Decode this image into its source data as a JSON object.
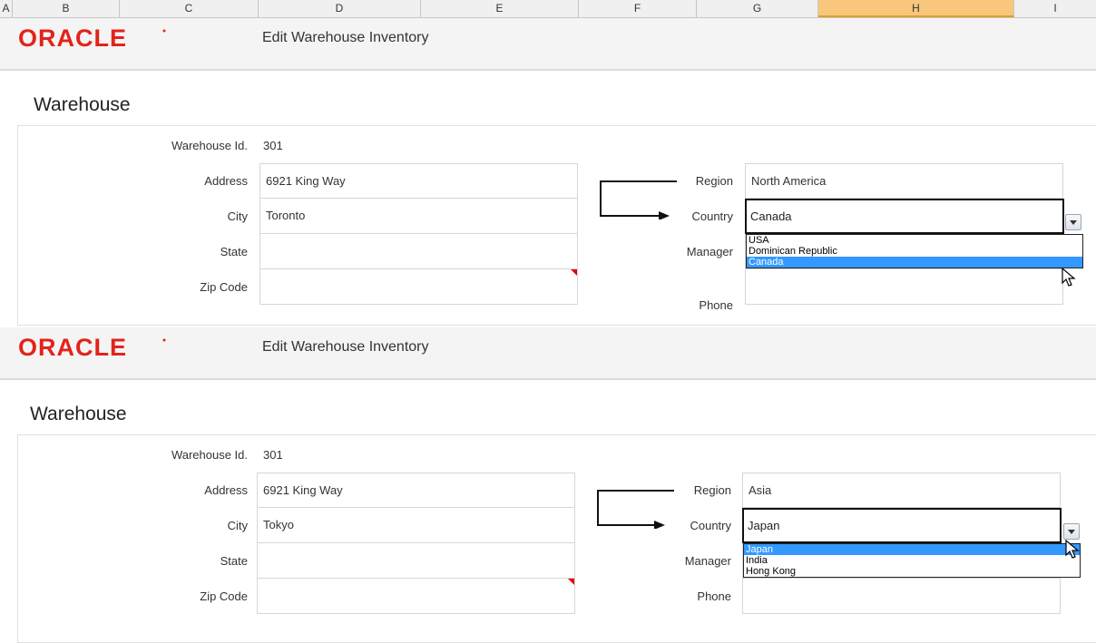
{
  "spreadsheet": {
    "columns": [
      "A",
      "B",
      "C",
      "D",
      "E",
      "F",
      "G",
      "H",
      "I"
    ],
    "selected_column": "H"
  },
  "panels": [
    {
      "logo": "ORACLE",
      "subtitle": "Edit Warehouse Inventory",
      "section_title": "Warehouse",
      "labels": {
        "warehouse_id": "Warehouse Id.",
        "address": "Address",
        "city": "City",
        "state": "State",
        "zip": "Zip Code",
        "region": "Region",
        "country": "Country",
        "manager": "Manager",
        "phone": "Phone"
      },
      "values": {
        "warehouse_id": "301",
        "address": "6921 King Way",
        "city": "Toronto",
        "state": "",
        "zip": "",
        "region": "North America",
        "country": "Canada",
        "manager": "",
        "phone": ""
      },
      "country_options": [
        "USA",
        "Dominican Republic",
        "Canada"
      ],
      "selected_option": "Canada"
    },
    {
      "logo": "ORACLE",
      "subtitle": "Edit Warehouse Inventory",
      "section_title": "Warehouse",
      "labels": {
        "warehouse_id": "Warehouse Id.",
        "address": "Address",
        "city": "City",
        "state": "State",
        "zip": "Zip Code",
        "region": "Region",
        "country": "Country",
        "manager": "Manager",
        "phone": "Phone"
      },
      "values": {
        "warehouse_id": "301",
        "address": "6921 King Way",
        "city": "Tokyo",
        "state": "",
        "zip": "",
        "region": "Asia",
        "country": "Japan",
        "manager": "",
        "phone": ""
      },
      "country_options": [
        "Japan",
        "India",
        "Hong Kong"
      ],
      "selected_option": "Japan"
    }
  ],
  "colors": {
    "oracle_red": "#e2231a",
    "selection_blue": "#3399ff",
    "selected_column_fill": "#f8c77c"
  }
}
